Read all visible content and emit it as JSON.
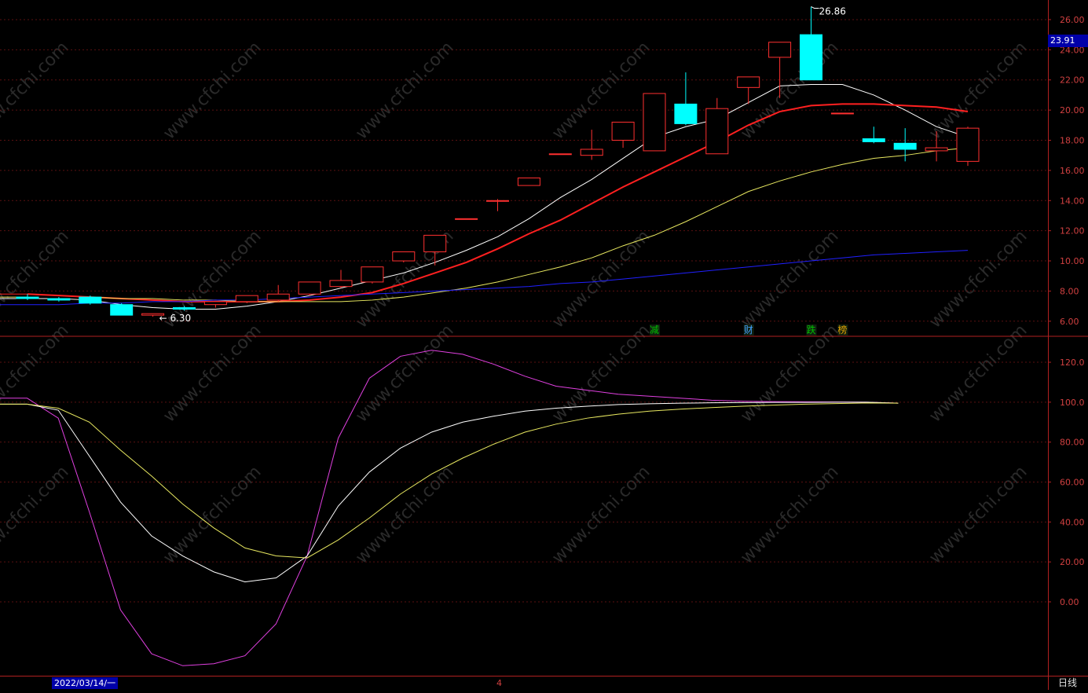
{
  "chart_data": [
    {
      "type": "candlestick",
      "price_axis_ticks": [
        26,
        24,
        22,
        20,
        18,
        16,
        14,
        12,
        10,
        8,
        6
      ],
      "price_axis_labels": [
        "26.00",
        "24.00",
        "22.00",
        "20.00",
        "18.00",
        "16.00",
        "14.00",
        "12.00",
        "10.00",
        "8.00",
        "6.00"
      ],
      "ylim": [
        5.0,
        27.3
      ],
      "current_price_label": "23.91",
      "current_price": 23.91,
      "high_annotation": "26.86",
      "low_annotation": "6.30",
      "candles": [
        {
          "o": 7.6,
          "h": 7.8,
          "c": 7.5,
          "l": 7.4
        },
        {
          "o": 7.5,
          "h": 7.6,
          "c": 7.4,
          "l": 7.3
        },
        {
          "o": 7.6,
          "h": 7.7,
          "c": 7.2,
          "l": 7.1
        },
        {
          "o": 7.1,
          "h": 7.2,
          "c": 6.4,
          "l": 6.4
        },
        {
          "o": 6.4,
          "h": 6.5,
          "c": 6.5,
          "l": 6.3
        },
        {
          "o": 6.9,
          "h": 7.0,
          "c": 6.8,
          "l": 6.7
        },
        {
          "o": 7.1,
          "h": 7.3,
          "c": 7.3,
          "l": 6.9
        },
        {
          "o": 7.3,
          "h": 7.7,
          "c": 7.7,
          "l": 7.2
        },
        {
          "o": 7.4,
          "h": 8.4,
          "c": 7.8,
          "l": 7.3
        },
        {
          "o": 7.8,
          "h": 8.5,
          "c": 8.6,
          "l": 7.7
        },
        {
          "o": 8.3,
          "h": 9.4,
          "c": 8.7,
          "l": 8.2
        },
        {
          "o": 8.6,
          "h": 9.6,
          "c": 9.6,
          "l": 8.5
        },
        {
          "o": 10.0,
          "h": 10.6,
          "c": 10.6,
          "l": 9.9
        },
        {
          "o": 10.6,
          "h": 11.7,
          "c": 11.7,
          "l": 9.7
        },
        {
          "o": 12.8,
          "h": 12.8,
          "c": 12.8,
          "l": 12.8
        },
        {
          "o": 14.0,
          "h": 14.1,
          "c": 14.0,
          "l": 13.3
        },
        {
          "o": 15.0,
          "h": 15.5,
          "c": 15.5,
          "l": 15.0
        },
        {
          "o": 17.1,
          "h": 17.1,
          "c": 17.1,
          "l": 17.1
        },
        {
          "o": 17.0,
          "h": 18.7,
          "c": 17.4,
          "l": 16.7
        },
        {
          "o": 18.0,
          "h": 19.2,
          "c": 19.2,
          "l": 17.5
        },
        {
          "o": 17.3,
          "h": 21.1,
          "c": 21.1,
          "l": 17.3
        },
        {
          "o": 20.4,
          "h": 22.5,
          "c": 19.1,
          "l": 19.0
        },
        {
          "o": 17.1,
          "h": 20.8,
          "c": 20.1,
          "l": 17.1
        },
        {
          "o": 21.5,
          "h": 22.2,
          "c": 22.2,
          "l": 20.4
        },
        {
          "o": 23.5,
          "h": 24.5,
          "c": 24.5,
          "l": 20.8
        },
        {
          "o": 25.0,
          "h": 26.86,
          "c": 22.0,
          "l": 22.0
        },
        {
          "o": 19.8,
          "h": 19.8,
          "c": 19.8,
          "l": 19.8
        },
        {
          "o": 18.1,
          "h": 18.9,
          "c": 17.9,
          "l": 17.8
        },
        {
          "o": 17.8,
          "h": 18.8,
          "c": 17.4,
          "l": 16.6
        },
        {
          "o": 17.3,
          "h": 18.6,
          "c": 17.5,
          "l": 16.6
        },
        {
          "o": 16.6,
          "h": 18.9,
          "c": 18.8,
          "l": 16.3
        }
      ],
      "ma_lines": [
        {
          "color": "#ffffff",
          "values": [
            7.5,
            7.5,
            7.4,
            7.1,
            6.9,
            6.8,
            6.8,
            7.0,
            7.3,
            7.7,
            8.2,
            8.7,
            9.2,
            9.9,
            10.7,
            11.6,
            12.8,
            14.2,
            15.4,
            16.8,
            18.2,
            18.9,
            19.4,
            20.5,
            21.6,
            21.7,
            21.7,
            21.0,
            20.0,
            18.9,
            18.2
          ]
        },
        {
          "color": "#ff2020",
          "values": [
            7.8,
            7.7,
            7.6,
            7.5,
            7.4,
            7.3,
            7.3,
            7.3,
            7.3,
            7.4,
            7.6,
            7.9,
            8.5,
            9.2,
            9.9,
            10.8,
            11.8,
            12.7,
            13.8,
            14.9,
            15.9,
            16.9,
            17.9,
            19.0,
            19.9,
            20.3,
            20.4,
            20.4,
            20.3,
            20.2,
            19.9
          ]
        },
        {
          "color": "#e8e860",
          "values": [
            7.6,
            7.5,
            7.5,
            7.4,
            7.4,
            7.3,
            7.3,
            7.3,
            7.3,
            7.4,
            7.6,
            7.9,
            8.2,
            8.6,
            9.1,
            9.6,
            10.2,
            11.0,
            11.7,
            12.6,
            13.6,
            14.6,
            15.3,
            15.9,
            16.4,
            16.8,
            17.0,
            17.3,
            17.5
          ]
        },
        {
          "color": "#2020ff",
          "values": [
            7.1,
            7.1,
            7.2,
            7.2,
            7.3,
            7.3,
            7.4,
            7.4,
            7.5,
            7.6,
            7.7,
            7.8,
            7.9,
            8.0,
            8.1,
            8.2,
            8.3,
            8.5,
            8.6,
            8.8,
            9.0,
            9.2,
            9.4,
            9.6,
            9.8,
            10.0,
            10.2,
            10.4,
            10.5,
            10.6,
            10.7
          ]
        }
      ],
      "event_markers": [
        {
          "label": "减",
          "index": 20,
          "color": "#00c000"
        },
        {
          "label": "财",
          "index": 23,
          "color": "#40a0ff"
        },
        {
          "label": "跌",
          "index": 25,
          "color": "#00c000"
        },
        {
          "label": "榜",
          "index": 26,
          "color": "#e0a000"
        }
      ]
    },
    {
      "type": "line",
      "axis_ticks": [
        120,
        100,
        80,
        60,
        40,
        20,
        0
      ],
      "axis_labels": [
        "120.0",
        "100.0",
        "80.00",
        "60.00",
        "40.00",
        "20.00",
        "0.00"
      ],
      "ylim": [
        -37,
        133
      ],
      "series": [
        {
          "color": "#e040e0",
          "values": [
            102,
            102,
            92,
            45,
            -4,
            -26,
            -32,
            -31,
            -27,
            -11,
            23,
            82,
            112,
            123,
            126,
            124,
            119,
            113,
            108,
            106,
            104,
            103,
            102,
            101,
            100.5,
            100.3,
            100.2,
            100.1,
            100,
            99.5
          ]
        },
        {
          "color": "#ffffff",
          "values": [
            99,
            99,
            96,
            73,
            50,
            33,
            23,
            15,
            10,
            12,
            23,
            48,
            65,
            77,
            85,
            90,
            93,
            95.5,
            97,
            98,
            98.8,
            99.2,
            99.5,
            99.7,
            99.8,
            99.9,
            99.9,
            100,
            100,
            99.5
          ]
        },
        {
          "color": "#e8e860",
          "values": [
            99,
            99,
            97,
            90,
            76,
            63,
            49,
            37,
            27,
            23,
            22,
            31,
            42,
            54,
            64,
            72,
            79,
            85,
            89,
            92,
            94,
            95.5,
            96.5,
            97.3,
            98,
            98.5,
            99,
            99.3,
            99.6,
            99.5
          ]
        }
      ]
    }
  ],
  "footer": {
    "date_label": "2022/03/14/一",
    "marker_label": "4",
    "mode_label": "日线"
  },
  "watermark": "www.cfchi.com"
}
